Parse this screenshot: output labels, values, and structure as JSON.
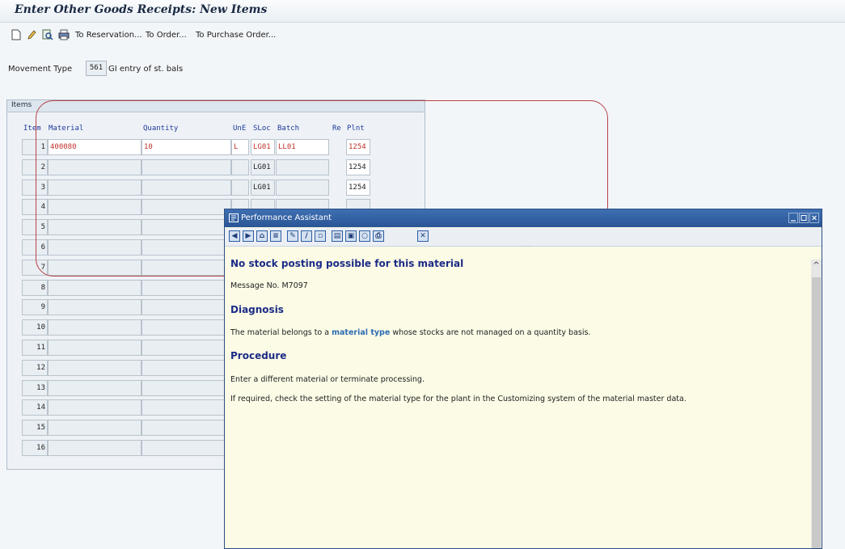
{
  "screen_title": "Enter Other Goods Receipts: New Items",
  "toolbar": {
    "icons": [
      "new-document-icon",
      "edit-pencil-icon",
      "find-icon",
      "print-icon"
    ],
    "links": [
      "To Reservation...",
      "To Order...",
      "To Purchase Order..."
    ]
  },
  "movement": {
    "label": "Movement Type",
    "code": "561",
    "description": "GI entry of st. bals"
  },
  "items": {
    "section_label": "Items",
    "headers": {
      "item": "Item",
      "material": "Material",
      "quantity": "Quantity",
      "une": "UnE",
      "sloc": "SLoc",
      "batch": "Batch",
      "re": "Re",
      "plnt": "Plnt"
    },
    "rows": [
      {
        "item": "1",
        "material": "400080",
        "quantity": "10",
        "une": "L",
        "sloc": "LG01",
        "batch": "LL01",
        "plnt": "1254"
      },
      {
        "item": "2",
        "material": "",
        "quantity": "",
        "une": "",
        "sloc": "LG01",
        "batch": "",
        "plnt": "1254"
      },
      {
        "item": "3",
        "material": "",
        "quantity": "",
        "une": "",
        "sloc": "LG01",
        "batch": "",
        "plnt": "1254"
      },
      {
        "item": "4",
        "material": "",
        "quantity": "",
        "une": "",
        "sloc": "",
        "batch": "",
        "plnt": ""
      },
      {
        "item": "5",
        "material": "",
        "quantity": "",
        "une": "",
        "sloc": "",
        "batch": "",
        "plnt": ""
      },
      {
        "item": "6",
        "material": "",
        "quantity": "",
        "une": "",
        "sloc": "",
        "batch": "",
        "plnt": ""
      },
      {
        "item": "7",
        "material": "",
        "quantity": "",
        "une": "",
        "sloc": "",
        "batch": "",
        "plnt": ""
      },
      {
        "item": "8",
        "material": "",
        "quantity": "",
        "une": "",
        "sloc": "",
        "batch": "",
        "plnt": ""
      },
      {
        "item": "9",
        "material": "",
        "quantity": "",
        "une": "",
        "sloc": "",
        "batch": "",
        "plnt": ""
      },
      {
        "item": "10",
        "material": "",
        "quantity": "",
        "une": "",
        "sloc": "",
        "batch": "",
        "plnt": ""
      },
      {
        "item": "11",
        "material": "",
        "quantity": "",
        "une": "",
        "sloc": "",
        "batch": "",
        "plnt": ""
      },
      {
        "item": "12",
        "material": "",
        "quantity": "",
        "une": "",
        "sloc": "",
        "batch": "",
        "plnt": ""
      },
      {
        "item": "13",
        "material": "",
        "quantity": "",
        "une": "",
        "sloc": "",
        "batch": "",
        "plnt": ""
      },
      {
        "item": "14",
        "material": "",
        "quantity": "",
        "une": "",
        "sloc": "",
        "batch": "",
        "plnt": ""
      },
      {
        "item": "15",
        "material": "",
        "quantity": "",
        "une": "",
        "sloc": "",
        "batch": "",
        "plnt": ""
      },
      {
        "item": "16",
        "material": "",
        "quantity": "",
        "une": "",
        "sloc": "",
        "batch": "",
        "plnt": ""
      }
    ]
  },
  "assistant": {
    "title": "Performance Assistant",
    "toolbar_icons": [
      "back-icon",
      "forward-icon",
      "home-icon",
      "tree-icon",
      "edit-icon",
      "pen-icon",
      "note-icon",
      "book-icon",
      "view-icon",
      "tip-icon",
      "print-icon",
      "close-icon"
    ],
    "heading": "No stock posting possible for this material",
    "message_no": "Message No. M7097",
    "diagnosis_heading": "Diagnosis",
    "diagnosis_before": "The material belongs to a ",
    "diagnosis_link": "material type",
    "diagnosis_after": " whose stocks are not managed on a quantity basis.",
    "procedure_heading": "Procedure",
    "procedure_line1": "Enter a different material or terminate processing.",
    "procedure_line2": "If required, check the setting of the material type for the plant in the Customizing system of the material master data."
  },
  "colors": {
    "accent_blue": "#2a5595",
    "heading_navy": "#1c2c86",
    "highlight_red": "#b74347",
    "error_red": "#c0302a"
  }
}
